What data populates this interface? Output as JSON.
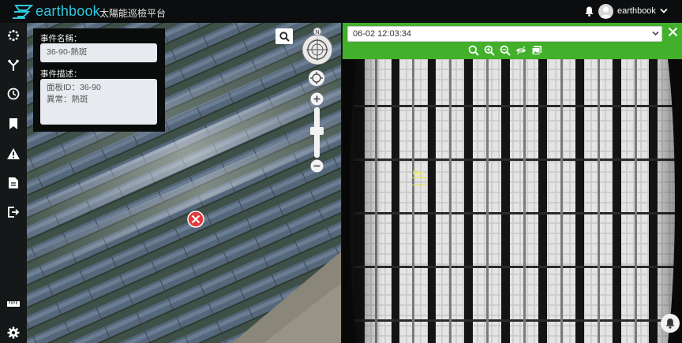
{
  "header": {
    "brand": "earthbook",
    "subtitle": "太陽能巡檢平台",
    "user": "earthbook",
    "brand_color": "#2ec7e0"
  },
  "sidebar": {
    "items": [
      {
        "icon": "layers-icon"
      },
      {
        "icon": "branch-icon"
      },
      {
        "icon": "clock-icon"
      },
      {
        "icon": "bookmark-icon"
      },
      {
        "icon": "warning-icon"
      },
      {
        "icon": "document-icon"
      },
      {
        "icon": "export-icon"
      },
      {
        "icon": "ruler-icon"
      },
      {
        "icon": "gear-icon"
      }
    ]
  },
  "event_panel": {
    "name_label": "事件名稱：",
    "name_value": "36-90-熱斑",
    "desc_label": "事件描述：",
    "desc_line1": "面板ID：36-90",
    "desc_line2": "異常：熱斑"
  },
  "map": {
    "compass_letter": "N"
  },
  "viewer": {
    "timestamp": "06-02 12:03:34",
    "accent": "#42b02b",
    "tools": [
      "search-icon",
      "zoom-in-icon",
      "zoom-out-icon",
      "hide-icon",
      "gallery-icon"
    ],
    "tag_label": "Gro"
  }
}
